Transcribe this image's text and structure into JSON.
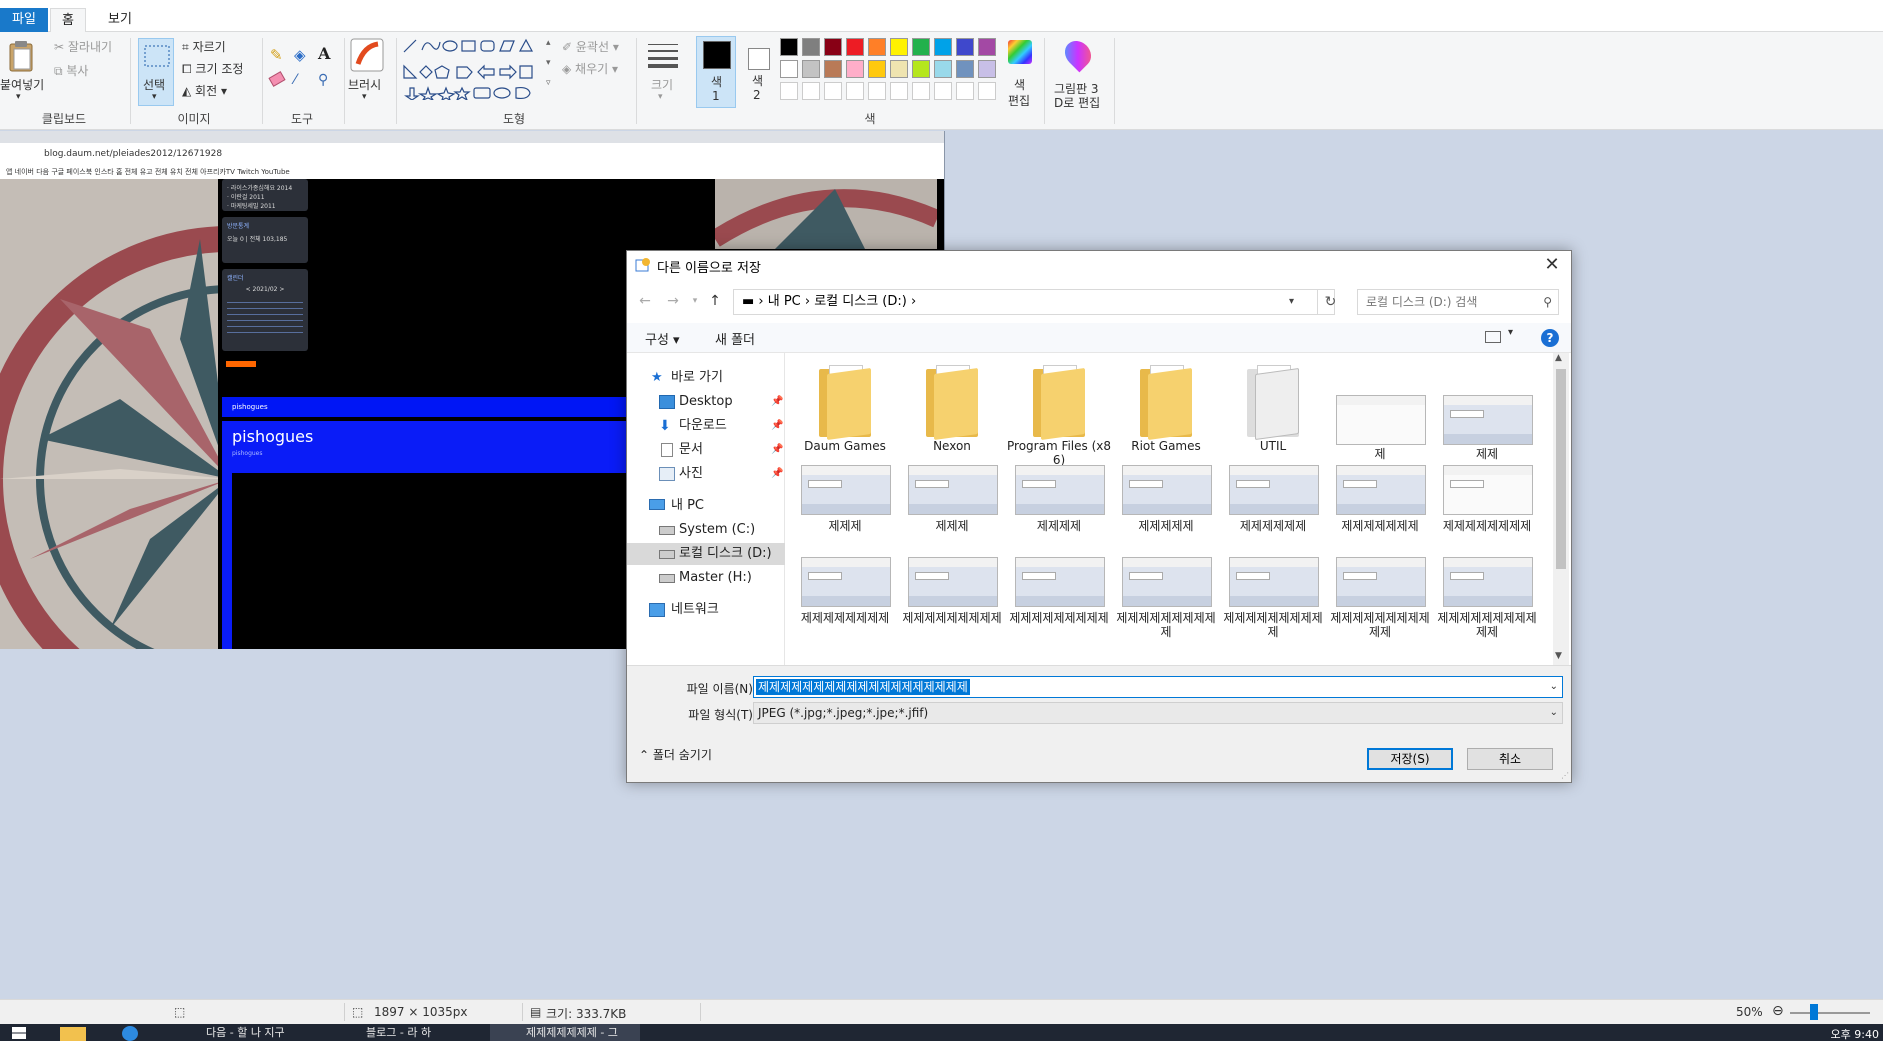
{
  "menu": {
    "file": "파일",
    "home": "홈",
    "view": "보기"
  },
  "ribbon": {
    "clipboard": {
      "paste": "붙여넣기",
      "cut": "잘라내기",
      "copy": "복사",
      "group": "클립보드"
    },
    "image": {
      "select": "선택",
      "crop": "자르기",
      "resize": "크기 조정",
      "rotate": "회전",
      "group": "이미지"
    },
    "tools": {
      "group": "도구"
    },
    "brush": {
      "label": "브러시"
    },
    "shapes": {
      "outline": "윤곽선",
      "fill": "채우기",
      "group": "도형"
    },
    "size": {
      "label": "크기"
    },
    "colors": {
      "color1": "색\n1",
      "color1_a": "색",
      "color1_b": "1",
      "color2_a": "색",
      "color2_b": "2",
      "edit_a": "색",
      "edit_b": "편집",
      "group": "색",
      "row1": [
        "#000000",
        "#7f7f7f",
        "#880015",
        "#ed1c24",
        "#ff7f27",
        "#fff200",
        "#22b14c",
        "#00a2e8",
        "#3f48cc",
        "#a349a4"
      ],
      "row2": [
        "#ffffff",
        "#c3c3c3",
        "#b97a57",
        "#ffaec9",
        "#ffc90e",
        "#efe4b0",
        "#b5e61d",
        "#99d9ea",
        "#7092be",
        "#c8bfe7"
      ]
    },
    "paint3d": {
      "line1": "그림판 3",
      "line2": "D로 편집"
    }
  },
  "canvas": {
    "address": "blog.daum.net/pleiades2012/12671928",
    "bookmarks": "앱  네이버  다음  구글  페이스북  인스타  홈 전체  유고 전체  유치 전체  아프리카TV  Twitch  YouTube",
    "blog_title": "pishogues",
    "blog_sub": "pishogues",
    "bar_label": "pishogues",
    "side1": [
      "· 라이스가종심해요 2014",
      "· 이란걸 2011",
      "· 마케팅세밀 2011"
    ],
    "side2_title": "방문통계",
    "side2_line": "오늘 0 | 전체 103,185",
    "side3_title": "캘린더",
    "side3_month": "< 2021/02 >"
  },
  "dialog": {
    "title": "다른 이름으로 저장",
    "breadcrumb": "▬  ›  내 PC  ›  로컬 디스크 (D:)  ›",
    "search_placeholder": "로컬 디스크 (D:) 검색",
    "organize": "구성 ▾",
    "new_folder": "새 폴더",
    "help": "?",
    "nav": {
      "quick": "바로 가기",
      "desktop": "Desktop",
      "downloads": "다운로드",
      "documents": "문서",
      "pictures": "사진",
      "mypc": "내 PC",
      "system": "System (C:)",
      "local": "로컬 디스크 (D:)",
      "master": "Master (H:)",
      "network": "네트워크"
    },
    "folders": [
      "Daum Games",
      "Nexon",
      "Program Files (x86)",
      "Riot Games",
      "UTIL"
    ],
    "files_row1": [
      "제",
      "제제"
    ],
    "files_row2": [
      "제제제",
      "제제제",
      "제제제제",
      "제제제제제",
      "제제제제제제",
      "제제제제제제제",
      "제제제제제제제제"
    ],
    "files_row3": [
      "제제제제제제제제",
      "제제제제제제제제제",
      "제제제제제제제제제",
      "제제제제제제제제제제",
      "제제제제제제제제제제",
      "제제제제제제제제제제제",
      "제제제제제제제제제제제"
    ],
    "filename_label": "파일 이름(N):",
    "filename_value": "제제제제제제제제제제제제제제제제제제제",
    "filetype_label": "파일 형식(T):",
    "filetype_value": "JPEG (*.jpg;*.jpeg;*.jpe;*.jfif)",
    "hide_folders": "폴더 숨기기",
    "save": "저장(S)",
    "cancel": "취소"
  },
  "status": {
    "dimensions": "1897 × 1035px",
    "size": "크기: 333.7KB",
    "zoom": "50%"
  },
  "taskbar": {
    "tasks": [
      "다음 - 할 나 지구",
      "블로그 - 라 하",
      "제제제제제제제 - 그"
    ],
    "clock": "오후 9:40"
  }
}
